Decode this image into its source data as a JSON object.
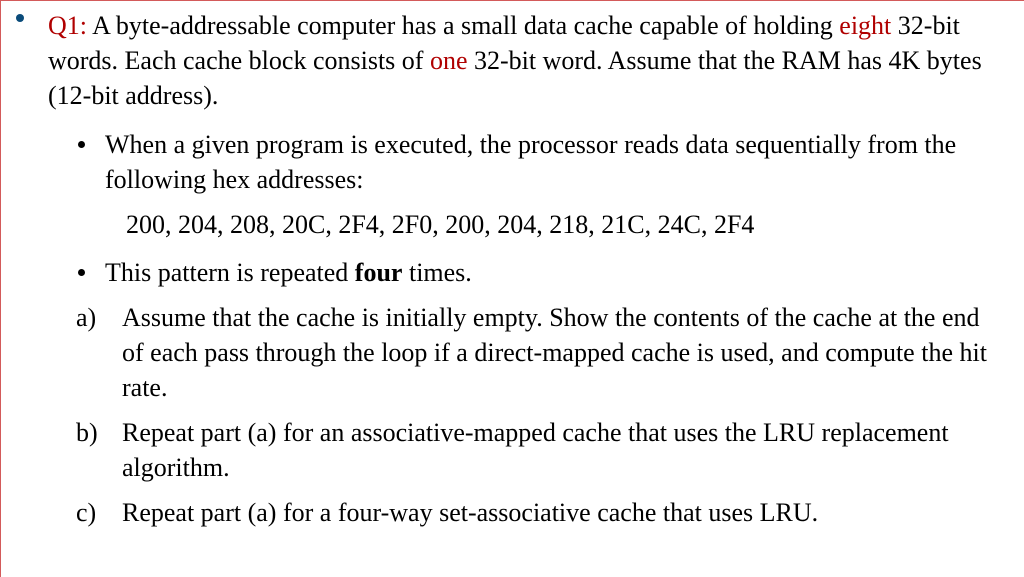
{
  "question": {
    "label": "Q1:",
    "intro_part1": " A byte-addressable computer has a small data cache capable of holding ",
    "highlight1": "eight",
    "intro_part2": " 32-bit words. Each cache block consists of ",
    "highlight2": "one",
    "intro_part3": " 32-bit word. Assume that the RAM has 4K bytes (12-bit address)."
  },
  "bullet1": "When a given program is executed, the processor reads data sequentially from the following hex addresses:",
  "addresses": "200, 204, 208, 20C, 2F4, 2F0, 200, 204, 218, 21C, 24C, 2F4",
  "bullet2_part1": "This pattern is repeated ",
  "bullet2_bold": "four",
  "bullet2_part2": " times.",
  "items": {
    "a": {
      "label": "a)",
      "text": "Assume that the cache is initially empty. Show the contents of the cache at the end of each pass through the loop if a direct-mapped cache is used, and compute the hit rate."
    },
    "b": {
      "label": "b)",
      "text": "Repeat part (a) for an associative-mapped cache that uses the LRU replacement algorithm."
    },
    "c": {
      "label": "c)",
      "text": "Repeat part (a) for a four-way set-associative cache that uses LRU."
    }
  }
}
